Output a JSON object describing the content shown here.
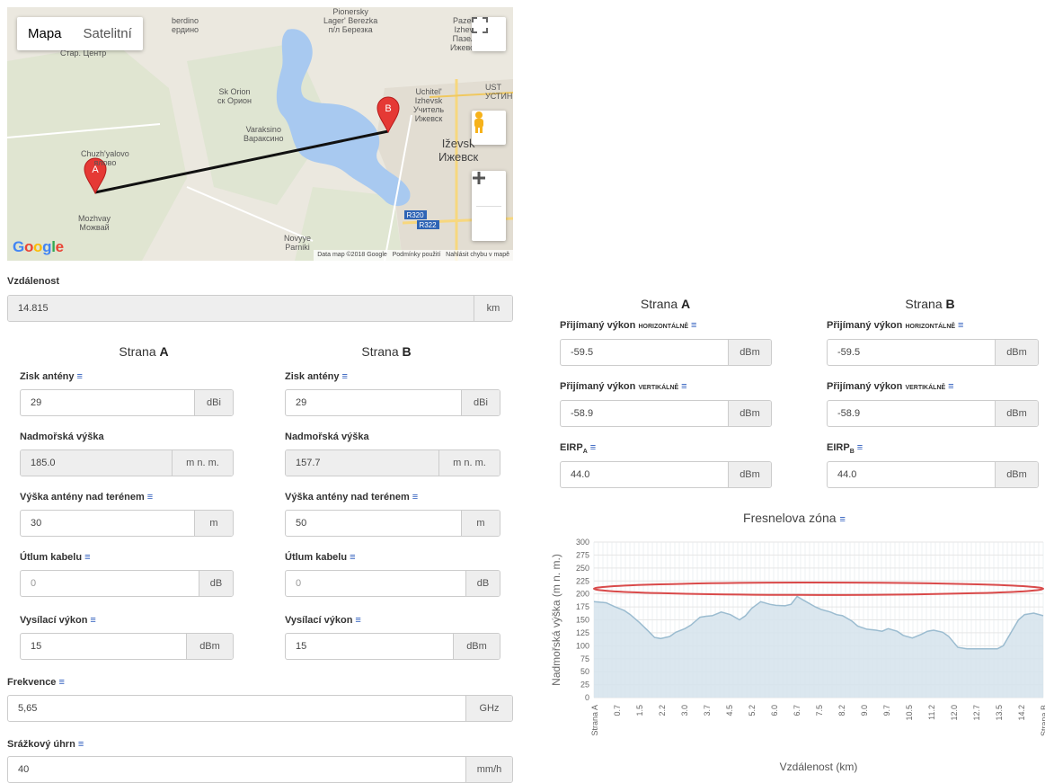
{
  "map": {
    "toggle": [
      "Mapa",
      "Satelitní"
    ],
    "places": [
      "Pionersky",
      "Lager' Berezka",
      "п/л Березка",
      "Pazeli",
      "Izhev",
      "Пазел",
      "Ижевск",
      "berdino",
      "ердино",
      "Стар. Центр",
      "Sk Orion",
      "ск Орион",
      "Varaksino",
      "Вараксино",
      "Uchitel'",
      "Izhevsk",
      "Учитель",
      "Ижевск",
      "UST",
      "УСТИН",
      "Iževsk",
      "Ижевск",
      "Chuzh'yalovo",
      "ялово",
      "Mozhvay",
      "Можвай",
      "Novyye",
      "Parniki",
      "R320",
      "R322"
    ],
    "markers": [
      "A",
      "B"
    ],
    "google": "Google",
    "attribution": [
      "Data map ©2018 Google",
      "Podmínky použití",
      "Nahlásit chybu v mapě"
    ],
    "icons": [
      "fullscreen-icon",
      "pegman-icon",
      "plus-icon",
      "minus-icon"
    ]
  },
  "distance": {
    "label": "Vzdálenost",
    "value": "14.815",
    "unit": "km"
  },
  "sideA_title": [
    "Strana ",
    "A"
  ],
  "sideB_title": [
    "Strana ",
    "B"
  ],
  "info_glyph": "≡",
  "params": {
    "gain_label": "Zisk antény",
    "altitude_label": "Nadmořská výška",
    "height_label": "Výška antény nad terénem",
    "cable_label": "Útlum kabelu",
    "power_label": "Vysílací výkon",
    "a": {
      "gain": "29",
      "gain_unit": "dBi",
      "altitude": "185.0",
      "altitude_unit": "m n. m.",
      "height": "30",
      "height_unit": "m",
      "cable": "0",
      "cable_unit": "dB",
      "power": "15",
      "power_unit": "dBm"
    },
    "b": {
      "gain": "29",
      "gain_unit": "dBi",
      "altitude": "157.7",
      "altitude_unit": "m n. m.",
      "height": "50",
      "height_unit": "m",
      "cable": "0",
      "cable_unit": "dB",
      "power": "15",
      "power_unit": "dBm"
    }
  },
  "frequency": {
    "label": "Frekvence",
    "value": "5,65",
    "unit": "GHz"
  },
  "rain": {
    "label": "Srážkový úhrn",
    "value": "40",
    "unit": "mm/h"
  },
  "results": {
    "rx_label": "Přijímaný výkon",
    "horizontal": "HORIZONTÁLNĚ",
    "vertical": "VERTIKÁLNĚ",
    "eirp_label": "EIRP",
    "sub_a": "A",
    "sub_b": "B",
    "a": {
      "rx_h": "-59.5",
      "rx_v": "-58.9",
      "eirp": "44.0",
      "unit": "dBm"
    },
    "b": {
      "rx_h": "-59.5",
      "rx_v": "-58.9",
      "eirp": "44.0",
      "unit": "dBm"
    }
  },
  "chart_data": {
    "type": "area",
    "title": "Fresnelova zóna",
    "xlabel": "Vzdálenost (km)",
    "ylabel": "Nadmořská výška (m n. m.)",
    "ylim": [
      0,
      300
    ],
    "yticks": [
      0,
      25,
      50,
      75,
      100,
      125,
      150,
      175,
      200,
      225,
      250,
      275,
      300
    ],
    "xticks": [
      "Strana A",
      "0.7",
      "1.5",
      "2.2",
      "3.0",
      "3.7",
      "4.5",
      "5.2",
      "6.0",
      "6.7",
      "7.5",
      "8.2",
      "9.0",
      "9.7",
      "10.5",
      "11.2",
      "12.0",
      "12.7",
      "13.5",
      "14.2",
      "Strana B"
    ],
    "xlim": [
      0,
      14.815
    ],
    "terrain": {
      "x": [
        0,
        0.4,
        0.7,
        1.0,
        1.2,
        1.5,
        1.8,
        2.0,
        2.2,
        2.5,
        2.7,
        3.0,
        3.2,
        3.5,
        3.7,
        3.9,
        4.2,
        4.5,
        4.8,
        5.0,
        5.2,
        5.5,
        5.8,
        6.0,
        6.3,
        6.5,
        6.7,
        7.0,
        7.3,
        7.5,
        7.8,
        8.0,
        8.2,
        8.5,
        8.7,
        9.0,
        9.3,
        9.5,
        9.7,
        10.0,
        10.2,
        10.5,
        10.8,
        11.0,
        11.2,
        11.5,
        11.7,
        12.0,
        12.3,
        12.5,
        12.7,
        13.0,
        13.3,
        13.5,
        13.8,
        14.0,
        14.2,
        14.5,
        14.815
      ],
      "y": [
        185,
        183,
        175,
        168,
        160,
        145,
        128,
        116,
        114,
        118,
        126,
        133,
        140,
        155,
        157,
        158,
        165,
        160,
        150,
        158,
        172,
        185,
        180,
        178,
        177,
        180,
        195,
        185,
        175,
        170,
        165,
        160,
        158,
        148,
        138,
        132,
        130,
        128,
        133,
        128,
        120,
        115,
        122,
        128,
        130,
        126,
        118,
        97,
        94,
        94,
        94,
        94,
        94,
        100,
        130,
        150,
        160,
        163,
        158
      ]
    },
    "fresnel_ellipse": {
      "x_start": 0,
      "x_end": 14.815,
      "center_y": 210,
      "y_min": 198,
      "y_max": 222
    }
  }
}
